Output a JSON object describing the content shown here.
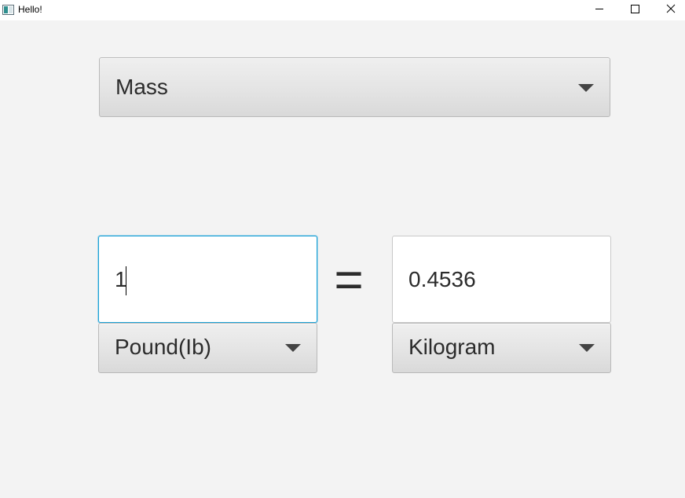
{
  "window": {
    "title": "Hello!",
    "icon": "java-app-icon",
    "controls": {
      "minimize": "minimize-icon",
      "maximize": "maximize-icon",
      "close": "close-icon"
    }
  },
  "category": {
    "selected": "Mass"
  },
  "from": {
    "value": "1",
    "unit": "Pound(Ib)"
  },
  "equals": "=",
  "to": {
    "value": "0.4536",
    "unit": "Kilogram"
  },
  "colors": {
    "background": "#f3f3f3",
    "focus_border": "#1ba1d6",
    "text": "#2b2b2b",
    "arrow": "#444444"
  }
}
